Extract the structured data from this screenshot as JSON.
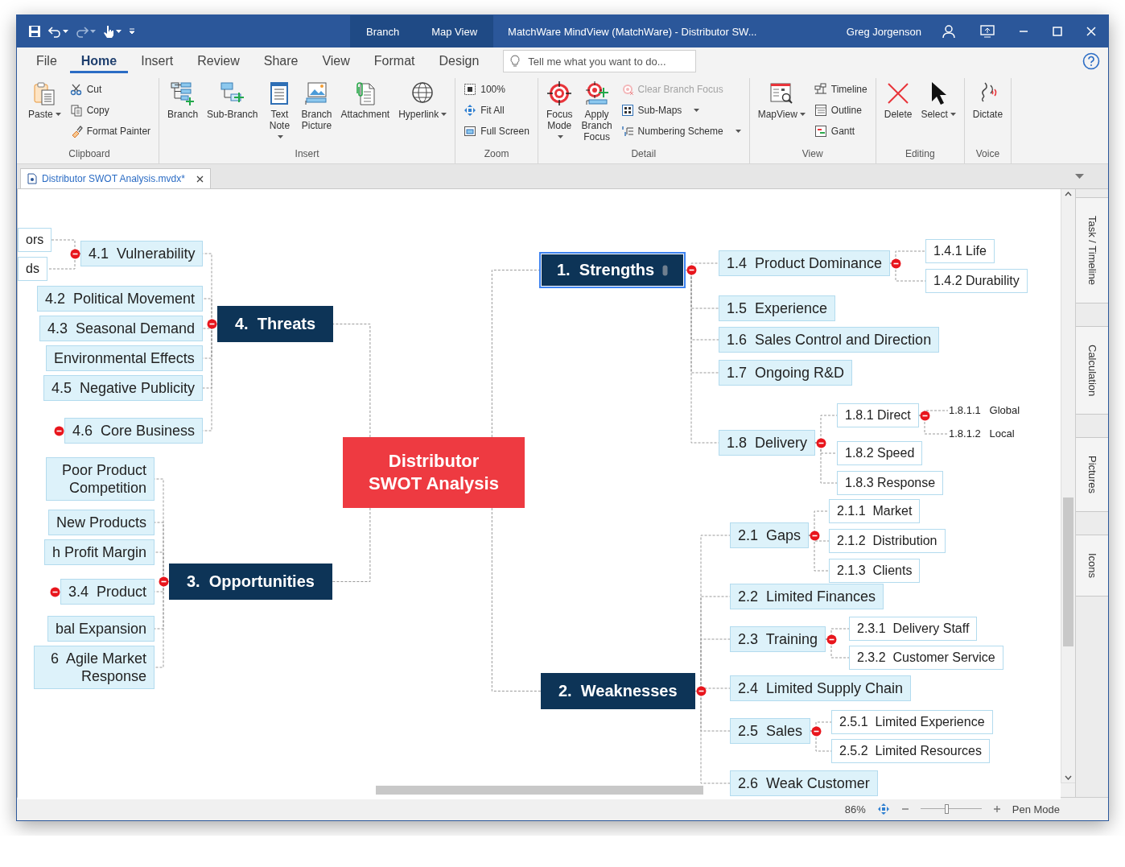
{
  "title_bar": {
    "contextual_tabs": [
      {
        "label": "Branch"
      },
      {
        "label": "Map View"
      }
    ],
    "title": "MatchWare MindView (MatchWare) - Distributor SW...",
    "user": "Greg Jorgenson"
  },
  "ribbon": {
    "tabs": [
      {
        "label": "File",
        "selected": false
      },
      {
        "label": "Home",
        "selected": true
      },
      {
        "label": "Insert",
        "selected": false
      },
      {
        "label": "Review",
        "selected": false
      },
      {
        "label": "Share",
        "selected": false
      },
      {
        "label": "View",
        "selected": false
      },
      {
        "label": "Format",
        "selected": false
      },
      {
        "label": "Design",
        "selected": false
      }
    ],
    "search": {
      "placeholder": "Tell me what you want to do..."
    },
    "groups": [
      {
        "title": "Clipboard",
        "items": [
          {
            "label": "Paste",
            "kind": "large",
            "dropdown": true,
            "disabled": false
          },
          {
            "label": "Cut",
            "kind": "small",
            "dropdown": false,
            "disabled": false
          },
          {
            "label": "Copy",
            "kind": "small",
            "dropdown": false,
            "disabled": false
          },
          {
            "label": "Format Painter",
            "kind": "small",
            "dropdown": false,
            "disabled": false
          }
        ]
      },
      {
        "title": "Insert",
        "items": [
          {
            "label": "Branch",
            "kind": "large",
            "dropdown": false,
            "disabled": false
          },
          {
            "label": "Sub-Branch",
            "kind": "large",
            "dropdown": false,
            "disabled": false
          },
          {
            "label": "Text Note",
            "kind": "large",
            "dropdown": true,
            "disabled": false
          },
          {
            "label": "Branch Picture",
            "kind": "large",
            "dropdown": false,
            "disabled": false
          },
          {
            "label": "Attachment",
            "kind": "large",
            "dropdown": false,
            "disabled": false
          },
          {
            "label": "Hyperlink",
            "kind": "large",
            "dropdown": true,
            "disabled": false
          }
        ]
      },
      {
        "title": "Zoom",
        "items": [
          {
            "label": "100%",
            "kind": "small",
            "dropdown": false,
            "disabled": false
          },
          {
            "label": "Fit All",
            "kind": "small",
            "dropdown": false,
            "disabled": false
          },
          {
            "label": "Full Screen",
            "kind": "small",
            "dropdown": false,
            "disabled": false
          }
        ]
      },
      {
        "title": "Detail",
        "items": [
          {
            "label": "Focus Mode",
            "kind": "large",
            "dropdown": true,
            "disabled": false
          },
          {
            "label": "Apply Branch Focus",
            "kind": "large",
            "dropdown": false,
            "disabled": false
          },
          {
            "label": "Clear Branch Focus",
            "kind": "small",
            "dropdown": false,
            "disabled": true
          },
          {
            "label": "Sub-Maps",
            "kind": "small",
            "dropdown": true,
            "disabled": false
          },
          {
            "label": "Numbering Scheme",
            "kind": "small",
            "dropdown": true,
            "disabled": false
          }
        ]
      },
      {
        "title": "View",
        "items": [
          {
            "label": "MapView",
            "kind": "large",
            "dropdown": true,
            "disabled": false
          },
          {
            "label": "Timeline",
            "kind": "small",
            "dropdown": false,
            "disabled": false
          },
          {
            "label": "Outline",
            "kind": "small",
            "dropdown": false,
            "disabled": false
          },
          {
            "label": "Gantt",
            "kind": "small",
            "dropdown": false,
            "disabled": false
          }
        ]
      },
      {
        "title": "Editing",
        "items": [
          {
            "label": "Delete",
            "kind": "large",
            "dropdown": false,
            "disabled": false
          },
          {
            "label": "Select",
            "kind": "large",
            "dropdown": true,
            "disabled": false
          }
        ]
      },
      {
        "title": "Voice",
        "items": [
          {
            "label": "Dictate",
            "kind": "large",
            "dropdown": false,
            "disabled": false
          }
        ]
      }
    ]
  },
  "document_tabs": [
    {
      "label": "Distributor SWOT Analysis.mvdx*",
      "selected": true
    }
  ],
  "map": {
    "central": {
      "label": "Distributor SWOT Analysis",
      "selected": false
    },
    "branches": [
      {
        "label": "1.  Strengths",
        "selected": true,
        "expanded": true,
        "note": true,
        "children": [
          {
            "label": "1.4  Product Dominance",
            "selected": false,
            "expanded": true,
            "children": [
              {
                "label": "1.4.1 Life",
                "selected": false,
                "expanded": false
              },
              {
                "label": "1.4.2 Durability",
                "selected": false,
                "expanded": false
              }
            ]
          },
          {
            "label": "1.5  Experience",
            "selected": false,
            "expanded": false
          },
          {
            "label": "1.6  Sales Control and Direction",
            "selected": false,
            "expanded": false
          },
          {
            "label": "1.7  Ongoing R&D",
            "selected": false,
            "expanded": false
          },
          {
            "label": "1.8  Delivery",
            "selected": false,
            "expanded": true,
            "children": [
              {
                "label": "1.8.1 Direct",
                "selected": false,
                "expanded": true,
                "children": [
                  {
                    "label": "1.8.1.1   Global",
                    "selected": false,
                    "expanded": false
                  },
                  {
                    "label": "1.8.1.2   Local",
                    "selected": false,
                    "expanded": false
                  }
                ]
              },
              {
                "label": "1.8.2 Speed",
                "selected": false,
                "expanded": false
              },
              {
                "label": "1.8.3 Response",
                "selected": false,
                "expanded": false
              }
            ]
          }
        ]
      },
      {
        "label": "4.  Threats",
        "selected": false,
        "expanded": true,
        "children": [
          {
            "label": "4.1  Vulnerability",
            "selected": false,
            "expanded": true,
            "children": [
              {
                "label": "ors",
                "selected": false,
                "expanded": false
              },
              {
                "label": "ds",
                "selected": false,
                "expanded": false
              }
            ]
          },
          {
            "label": "4.2  Political Movement",
            "selected": false,
            "expanded": false
          },
          {
            "label": "4.3  Seasonal Demand",
            "selected": false,
            "expanded": false
          },
          {
            "label": "Environmental Effects",
            "selected": false,
            "expanded": false
          },
          {
            "label": "4.5  Negative Publicity",
            "selected": false,
            "expanded": false
          },
          {
            "label": "4.6  Core Business",
            "selected": false,
            "expanded": true
          }
        ]
      },
      {
        "label": "3.  Opportunities",
        "selected": false,
        "expanded": true,
        "children": [
          {
            "label": "Poor Product Competition",
            "selected": false,
            "expanded": false
          },
          {
            "label": "New Products",
            "selected": false,
            "expanded": false
          },
          {
            "label": "h Profit Margin",
            "selected": false,
            "expanded": false
          },
          {
            "label": "3.4  Product",
            "selected": false,
            "expanded": true
          },
          {
            "label": "bal Expansion",
            "selected": false,
            "expanded": false
          },
          {
            "label": "6  Agile Market Response",
            "selected": false,
            "expanded": false
          }
        ]
      },
      {
        "label": "2.  Weaknesses",
        "selected": false,
        "expanded": true,
        "children": [
          {
            "label": "2.1  Gaps",
            "selected": false,
            "expanded": true,
            "children": [
              {
                "label": "2.1.1  Market",
                "selected": false,
                "expanded": false
              },
              {
                "label": "2.1.2  Distribution",
                "selected": false,
                "expanded": false
              },
              {
                "label": "2.1.3  Clients",
                "selected": false,
                "expanded": false
              }
            ]
          },
          {
            "label": "2.2  Limited Finances",
            "selected": false,
            "expanded": false
          },
          {
            "label": "2.3  Training",
            "selected": false,
            "expanded": true,
            "children": [
              {
                "label": "2.3.1  Delivery Staff",
                "selected": false,
                "expanded": false
              },
              {
                "label": "2.3.2  Customer Service",
                "selected": false,
                "expanded": false
              }
            ]
          },
          {
            "label": "2.4  Limited Supply Chain",
            "selected": false,
            "expanded": false
          },
          {
            "label": "2.5  Sales",
            "selected": false,
            "expanded": true,
            "children": [
              {
                "label": "2.5.1  Limited Experience",
                "selected": false,
                "expanded": false
              },
              {
                "label": "2.5.2  Limited Resources",
                "selected": false,
                "expanded": false
              }
            ]
          },
          {
            "label": "2.6  Weak Customer",
            "selected": false,
            "expanded": false
          }
        ]
      }
    ]
  },
  "side_panel": {
    "tabs": [
      {
        "label": "Task / Timeline"
      },
      {
        "label": "Calculation"
      },
      {
        "label": "Pictures"
      },
      {
        "label": "Icons"
      }
    ]
  },
  "status_bar": {
    "zoom": "86%",
    "zoom_slider": {
      "level": 0.43
    },
    "mode": "Pen Mode"
  }
}
